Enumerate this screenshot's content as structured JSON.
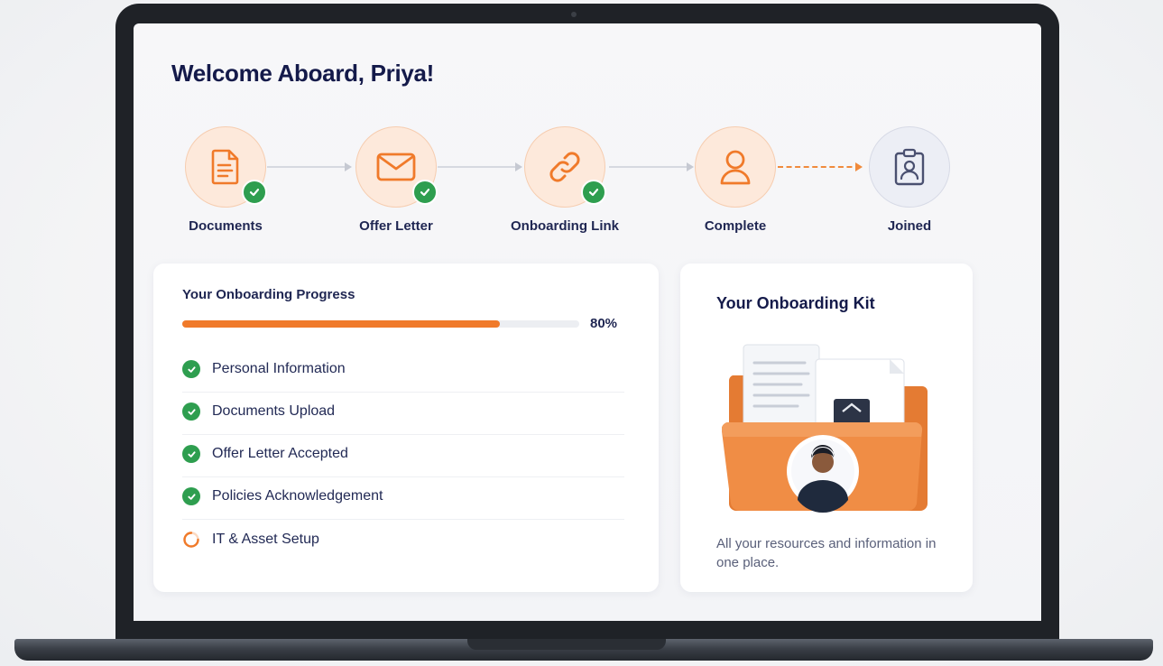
{
  "screen": {
    "title": "Welcome Aboard, Priya!"
  },
  "steps": [
    {
      "label": "Documents",
      "icon": "document-icon",
      "done": true
    },
    {
      "label": "Offer Letter",
      "icon": "envelope-icon",
      "done": true
    },
    {
      "label": "Onboarding Link",
      "icon": "link-icon",
      "done": true
    },
    {
      "label": "Complete",
      "icon": "user-icon",
      "done": false
    },
    {
      "label": "Joined",
      "icon": "id-badge-icon",
      "done": false
    }
  ],
  "progress": {
    "title": "Your Onboarding Progress",
    "percent_label": "80%",
    "percent": 80,
    "items": [
      {
        "label": "Personal Information",
        "status": "done"
      },
      {
        "label": "Documents Upload",
        "status": "done"
      },
      {
        "label": "Offer Letter Accepted",
        "status": "done"
      },
      {
        "label": "Policies Acknowledgement",
        "status": "done"
      },
      {
        "label": "IT & Asset Setup",
        "status": "in-progress"
      }
    ]
  },
  "kit": {
    "title": "Your Onboarding Kit",
    "caption": "All your resources and information in one place."
  },
  "colors": {
    "accent": "#f07a2a",
    "success": "#2e9e4f",
    "heading": "#141a4a"
  }
}
